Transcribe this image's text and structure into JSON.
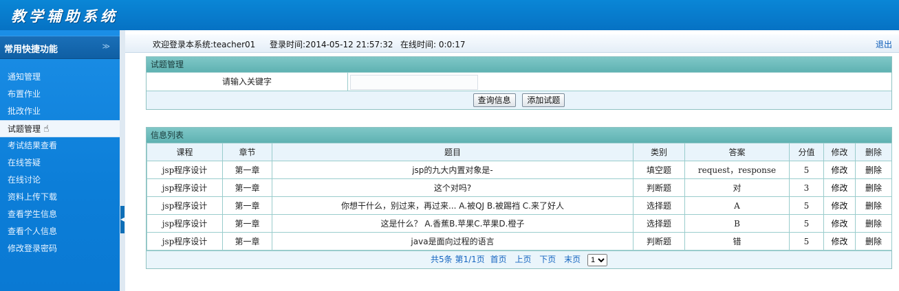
{
  "app": {
    "logo_text": "教学辅助系统"
  },
  "sidebar": {
    "title": "常用快捷功能",
    "chevron": "≫",
    "items": [
      {
        "label": "通知管理"
      },
      {
        "label": "布置作业"
      },
      {
        "label": "批改作业"
      },
      {
        "label": "试题管理",
        "active": true
      },
      {
        "label": "考试结果查看"
      },
      {
        "label": "在线答疑"
      },
      {
        "label": "在线讨论"
      },
      {
        "label": "资料上传下载"
      },
      {
        "label": "查看学生信息"
      },
      {
        "label": "查看个人信息"
      },
      {
        "label": "修改登录密码"
      }
    ]
  },
  "info_bar": {
    "welcome": "欢迎登录本系统:teacher01",
    "login_time": "登录时间:2014-05-12 21:57:32",
    "online_time": "在线时间: 0:0:17",
    "logout": "退出"
  },
  "search_panel": {
    "title": "试题管理",
    "keyword_label": "请输入关键字",
    "keyword_value": "",
    "query_button": "查询信息",
    "add_button": "添加试题"
  },
  "list_panel": {
    "title": "信息列表",
    "columns": [
      "课程",
      "章节",
      "题目",
      "类别",
      "答案",
      "分值",
      "修改",
      "删除"
    ],
    "rows": [
      [
        "jsp程序设计",
        "第一章",
        "jsp的九大内置对象是-",
        "填空题",
        "request，response",
        "5",
        "修改",
        "删除"
      ],
      [
        "jsp程序设计",
        "第一章",
        "这个对吗?",
        "判断题",
        "对",
        "3",
        "修改",
        "删除"
      ],
      [
        "jsp程序设计",
        "第一章",
        "你想干什么，别过来，再过来... A.被QJ B.被踢裆  C.来了好人",
        "选择题",
        "A",
        "5",
        "修改",
        "删除"
      ],
      [
        "jsp程序设计",
        "第一章",
        "这是什么？ A.香蕉B.苹果C.苹果D.橙子",
        "选择题",
        "B",
        "5",
        "修改",
        "删除"
      ],
      [
        "jsp程序设计",
        "第一章",
        "java是面向过程的语言",
        "判断题",
        "错",
        "5",
        "修改",
        "删除"
      ]
    ],
    "pager": {
      "summary": "共5条 第1/1页",
      "first": "首页",
      "prev": "上页",
      "next": "下页",
      "last": "末页",
      "page_select": "1"
    }
  }
}
